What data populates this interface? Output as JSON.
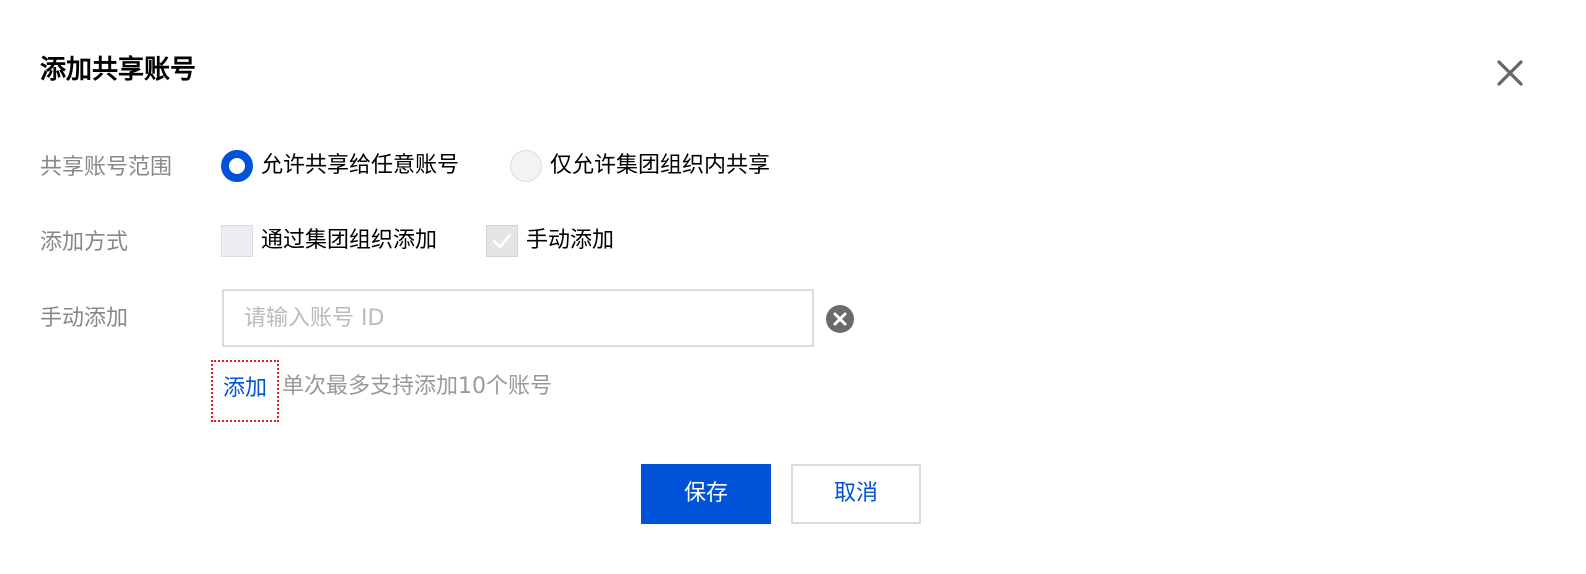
{
  "dialog": {
    "title": "添加共享账号"
  },
  "form": {
    "scope": {
      "label": "共享账号范围",
      "options": [
        {
          "label": "允许共享给任意账号",
          "checked": true
        },
        {
          "label": "仅允许集团组织内共享",
          "checked": false
        }
      ]
    },
    "method": {
      "label": "添加方式",
      "options": [
        {
          "label": "通过集团组织添加",
          "checked": false
        },
        {
          "label": "手动添加",
          "checked": true,
          "disabled": true
        }
      ]
    },
    "manual": {
      "label": "手动添加",
      "input_value": "",
      "input_placeholder": "请输入账号 ID",
      "add_link": "添加",
      "hint": "单次最多支持添加10个账号"
    }
  },
  "footer": {
    "save_label": "保存",
    "cancel_label": "取消"
  },
  "icons": {
    "close": "close-icon",
    "clear": "clear-circle-icon",
    "check": "check-icon"
  },
  "colors": {
    "primary": "#0052d9",
    "label_gray": "#888888",
    "border": "#dcdcdc",
    "highlight": "#e02020"
  }
}
